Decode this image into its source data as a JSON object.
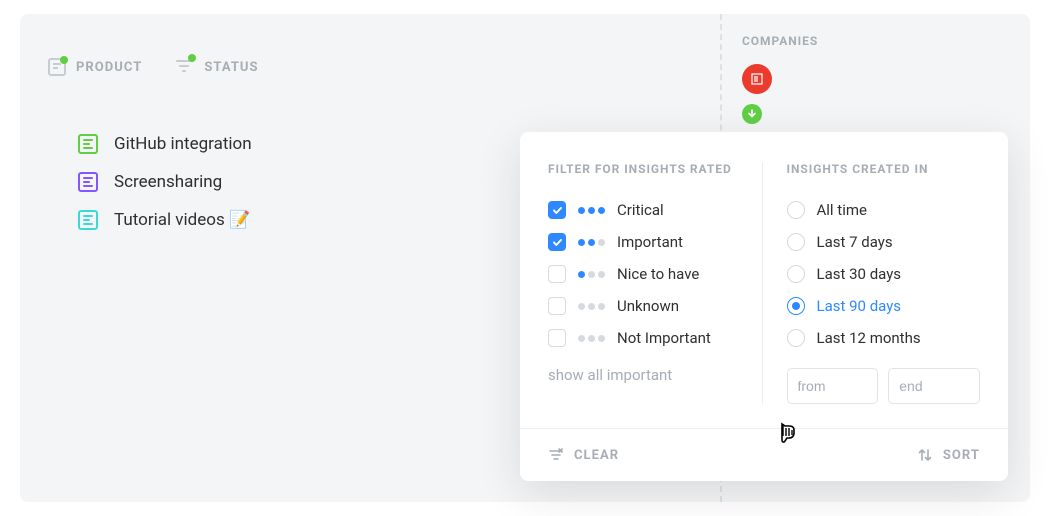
{
  "tabs": {
    "product": "PRODUCT",
    "status": "STATUS"
  },
  "products": [
    {
      "label": "GitHub integration",
      "color": "green"
    },
    {
      "label": "Screensharing",
      "color": "purple"
    },
    {
      "label": "Tutorial videos 📝",
      "color": "teal"
    }
  ],
  "companies": {
    "label": "COMPANIES"
  },
  "filter_panel": {
    "rating_header": "FILTER FOR INSIGHTS RATED",
    "ratings": [
      {
        "label": "Critical",
        "checked": true,
        "dots": 3
      },
      {
        "label": "Important",
        "checked": true,
        "dots": 2
      },
      {
        "label": "Nice to have",
        "checked": false,
        "dots": 1
      },
      {
        "label": "Unknown",
        "checked": false,
        "dots": 0
      },
      {
        "label": "Not Important",
        "checked": false,
        "dots": 0
      }
    ],
    "show_all": "show all important",
    "created_header": "INSIGHTS CREATED IN",
    "ranges": [
      {
        "label": "All time",
        "selected": false
      },
      {
        "label": "Last 7 days",
        "selected": false
      },
      {
        "label": "Last 30 days",
        "selected": false
      },
      {
        "label": "Last 90 days",
        "selected": true
      },
      {
        "label": "Last 12 months",
        "selected": false
      }
    ],
    "from_placeholder": "from",
    "end_placeholder": "end",
    "clear": "CLEAR",
    "sort": "SORT"
  }
}
